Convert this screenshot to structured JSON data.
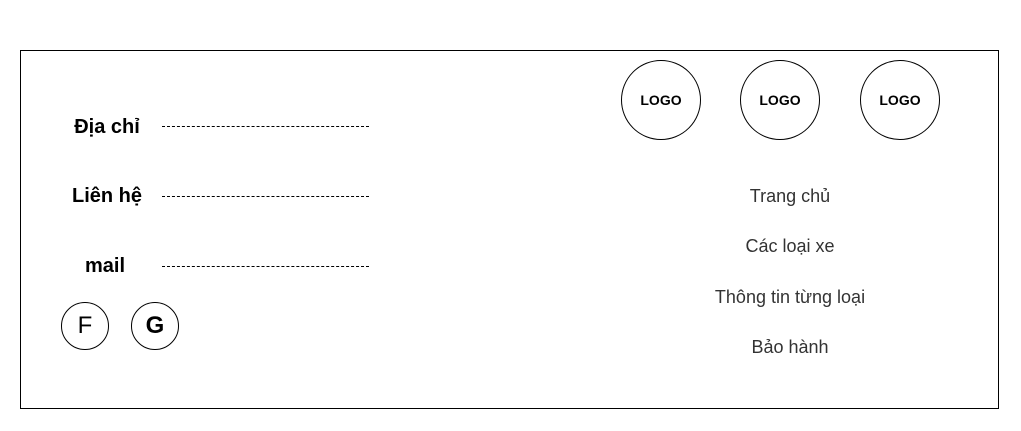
{
  "contact": {
    "address_label": "Địa chỉ",
    "phone_label": "Liên hệ",
    "mail_label": "mail"
  },
  "social": {
    "facebook_label": "F",
    "google_label": "G"
  },
  "logos": [
    "LOGO",
    "LOGO",
    "LOGO"
  ],
  "nav": [
    "Trang chủ",
    "Các loại xe",
    "Thông tin từng loại",
    "Bảo hành"
  ]
}
